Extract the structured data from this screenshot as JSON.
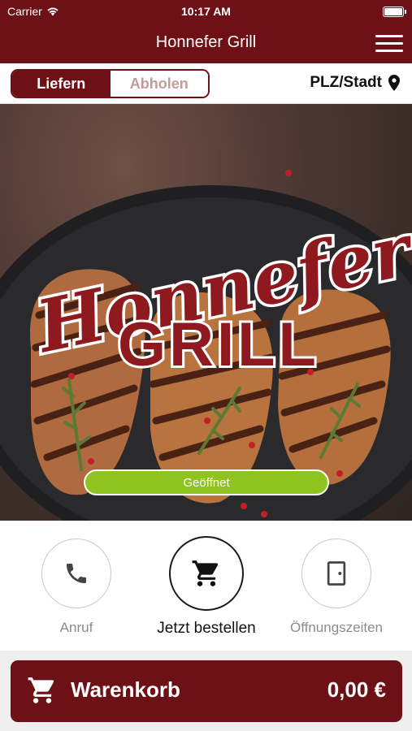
{
  "status_bar": {
    "carrier": "Carrier",
    "time": "10:17 AM"
  },
  "nav": {
    "title": "Honnefer Grill"
  },
  "mode_toggle": {
    "deliver_label": "Liefern",
    "pickup_label": "Abholen",
    "selected": "Liefern"
  },
  "location": {
    "label": "PLZ/Stadt"
  },
  "hero": {
    "logo_line1": "Honnefer",
    "logo_line2": "GRILL",
    "status_badge": "Geöffnet"
  },
  "actions": [
    {
      "label": "Anruf",
      "icon": "phone-icon"
    },
    {
      "label": "Jetzt bestellen",
      "icon": "cart-icon"
    },
    {
      "label": "Öffnungszeiten",
      "icon": "door-icon"
    }
  ],
  "cart": {
    "label": "Warenkorb",
    "total": "0,00 €"
  },
  "colors": {
    "brand": "#6e1116",
    "open_badge": "#8fc31f"
  }
}
